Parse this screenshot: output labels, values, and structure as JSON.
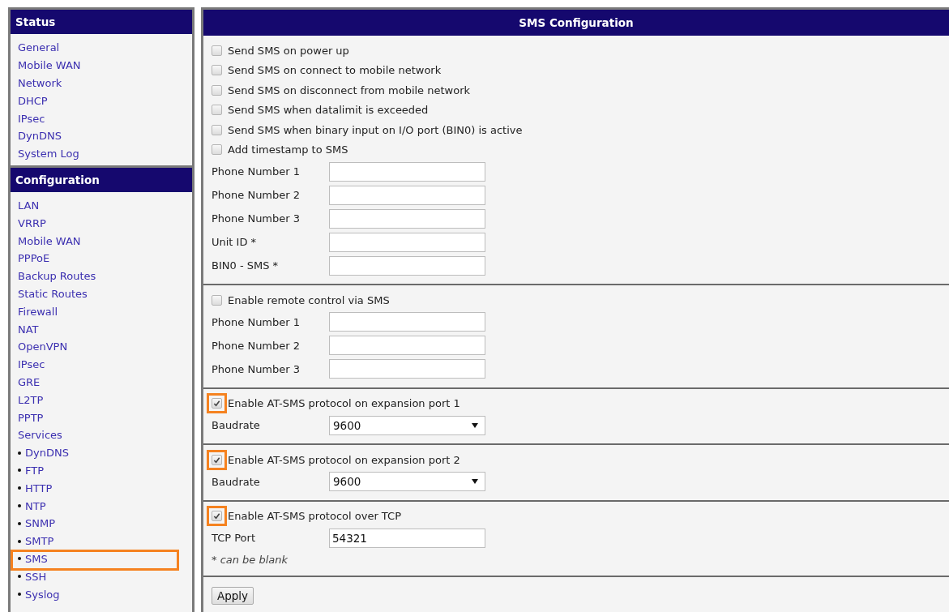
{
  "sidebar": {
    "groups": [
      {
        "title": "Status",
        "items": [
          {
            "label": "General",
            "kind": "link",
            "highlighted": false
          },
          {
            "label": "Mobile WAN",
            "kind": "link",
            "highlighted": false
          },
          {
            "label": "Network",
            "kind": "link",
            "highlighted": false
          },
          {
            "label": "DHCP",
            "kind": "link",
            "highlighted": false
          },
          {
            "label": "IPsec",
            "kind": "link",
            "highlighted": false
          },
          {
            "label": "DynDNS",
            "kind": "link",
            "highlighted": false
          },
          {
            "label": "System Log",
            "kind": "link",
            "highlighted": false
          }
        ]
      },
      {
        "title": "Configuration",
        "items": [
          {
            "label": "LAN",
            "kind": "link",
            "highlighted": false
          },
          {
            "label": "VRRP",
            "kind": "link",
            "highlighted": false
          },
          {
            "label": "Mobile WAN",
            "kind": "link",
            "highlighted": false
          },
          {
            "label": "PPPoE",
            "kind": "link",
            "highlighted": false
          },
          {
            "label": "Backup Routes",
            "kind": "link",
            "highlighted": false
          },
          {
            "label": "Static Routes",
            "kind": "link",
            "highlighted": false
          },
          {
            "label": "Firewall",
            "kind": "link",
            "highlighted": false
          },
          {
            "label": "NAT",
            "kind": "link",
            "highlighted": false
          },
          {
            "label": "OpenVPN",
            "kind": "link",
            "highlighted": false
          },
          {
            "label": "IPsec",
            "kind": "link",
            "highlighted": false
          },
          {
            "label": "GRE",
            "kind": "link",
            "highlighted": false
          },
          {
            "label": "L2TP",
            "kind": "link",
            "highlighted": false
          },
          {
            "label": "PPTP",
            "kind": "link",
            "highlighted": false
          },
          {
            "label": "Services",
            "kind": "link",
            "highlighted": false
          },
          {
            "label": "DynDNS",
            "kind": "bullet",
            "highlighted": false
          },
          {
            "label": "FTP",
            "kind": "bullet",
            "highlighted": false
          },
          {
            "label": "HTTP",
            "kind": "bullet",
            "highlighted": false
          },
          {
            "label": "NTP",
            "kind": "bullet",
            "highlighted": false
          },
          {
            "label": "SNMP",
            "kind": "bullet",
            "highlighted": false
          },
          {
            "label": "SMTP",
            "kind": "bullet",
            "highlighted": false
          },
          {
            "label": "SMS",
            "kind": "bullet",
            "highlighted": true
          },
          {
            "label": "SSH",
            "kind": "bullet",
            "highlighted": false
          },
          {
            "label": "Syslog",
            "kind": "bullet",
            "highlighted": false
          }
        ]
      }
    ]
  },
  "panel": {
    "title": "SMS Configuration",
    "sections": [
      {
        "rows": [
          {
            "kind": "checkbox",
            "label": "Send SMS on power up",
            "checked": false,
            "highlighted": false
          },
          {
            "kind": "checkbox",
            "label": "Send SMS on connect to mobile network",
            "checked": false,
            "highlighted": false
          },
          {
            "kind": "checkbox",
            "label": "Send SMS on disconnect from mobile network",
            "checked": false,
            "highlighted": false
          },
          {
            "kind": "checkbox",
            "label": "Send SMS when datalimit is exceeded",
            "checked": false,
            "highlighted": false
          },
          {
            "kind": "checkbox",
            "label": "Send SMS when binary input on I/O port (BIN0) is active",
            "checked": false,
            "highlighted": false
          },
          {
            "kind": "checkbox",
            "label": "Add timestamp to SMS",
            "checked": false,
            "highlighted": false
          },
          {
            "kind": "input",
            "label": "Phone Number 1"
          },
          {
            "kind": "input",
            "label": "Phone Number 2"
          },
          {
            "kind": "input",
            "label": "Phone Number 3"
          },
          {
            "kind": "input",
            "label": "Unit ID *"
          },
          {
            "kind": "input",
            "label": "BIN0 - SMS *"
          }
        ]
      },
      {
        "rows": [
          {
            "kind": "checkbox",
            "label": "Enable remote control via SMS",
            "checked": false,
            "highlighted": false
          },
          {
            "kind": "input",
            "label": "Phone Number 1"
          },
          {
            "kind": "input",
            "label": "Phone Number 2"
          },
          {
            "kind": "input",
            "label": "Phone Number 3"
          }
        ]
      },
      {
        "rows": [
          {
            "kind": "checkbox",
            "label": "Enable AT-SMS protocol on expansion port 1",
            "checked": true,
            "highlighted": true
          },
          {
            "kind": "select",
            "label": "Baudrate",
            "value": "9600"
          }
        ]
      },
      {
        "rows": [
          {
            "kind": "checkbox",
            "label": "Enable AT-SMS protocol on expansion port 2",
            "checked": true,
            "highlighted": true
          },
          {
            "kind": "select",
            "label": "Baudrate",
            "value": "9600"
          }
        ]
      },
      {
        "rows": [
          {
            "kind": "checkbox",
            "label": "Enable AT-SMS protocol over TCP",
            "checked": true,
            "highlighted": true
          },
          {
            "kind": "input",
            "label": "TCP Port",
            "value": "54321"
          },
          {
            "kind": "note",
            "label": "* can be blank"
          }
        ]
      }
    ],
    "button": "Apply"
  }
}
